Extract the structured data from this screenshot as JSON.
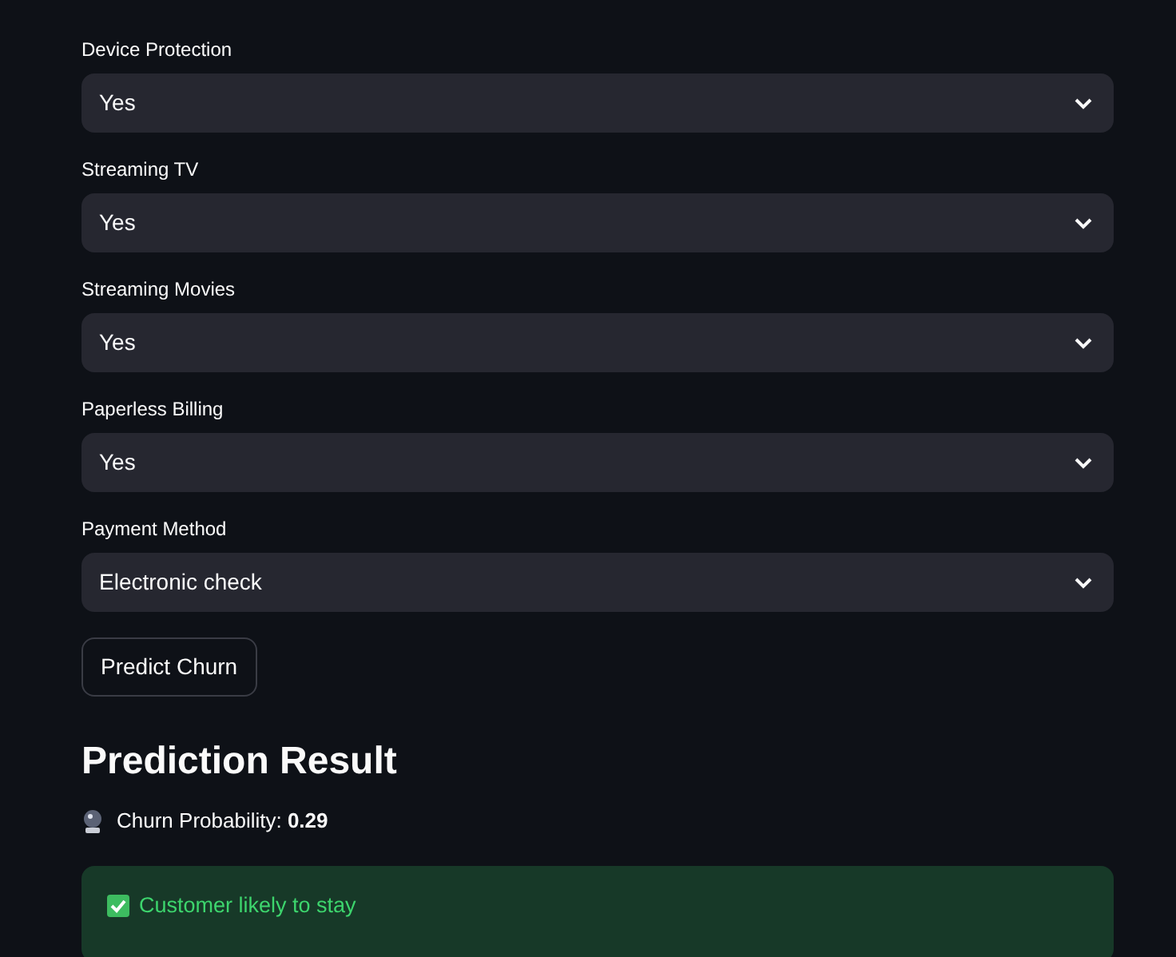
{
  "fields": [
    {
      "label": "Device Protection",
      "value": "Yes"
    },
    {
      "label": "Streaming TV",
      "value": "Yes"
    },
    {
      "label": "Streaming Movies",
      "value": "Yes"
    },
    {
      "label": "Paperless Billing",
      "value": "Yes"
    },
    {
      "label": "Payment Method",
      "value": "Electronic check"
    }
  ],
  "button": "Predict Churn",
  "result": {
    "heading": "Prediction Result",
    "probability": "Churn Probability: **0.29**",
    "message": "Customer likely to stay",
    "kind": "success"
  }
}
